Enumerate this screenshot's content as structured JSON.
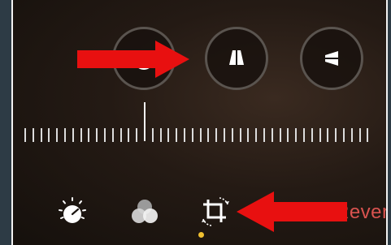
{
  "toolbar": {
    "revert_label": "Revert"
  },
  "perspective_buttons": [
    {
      "icon": "auto-straighten-icon"
    },
    {
      "icon": "vertical-perspective-icon"
    },
    {
      "icon": "horizontal-perspective-icon"
    }
  ],
  "bottom_tools": [
    {
      "icon": "adjust-dial-icon"
    },
    {
      "icon": "filters-icon"
    },
    {
      "icon": "crop-rotate-icon",
      "selected": true
    }
  ],
  "straighten_slider": {
    "value": 0
  },
  "colors": {
    "arrow": "#e81010",
    "revert": "#d9534f",
    "selected_dot": "#f0c030"
  }
}
